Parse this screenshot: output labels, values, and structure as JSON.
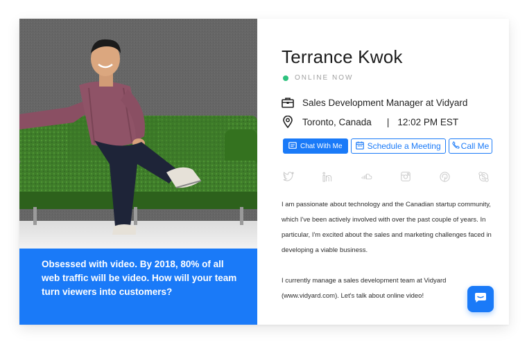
{
  "profile": {
    "name": "Terrance Kwok",
    "status": "ONLINE NOW",
    "role": "Sales Development Manager at Vidyard",
    "location": "Toronto, Canada",
    "separator": "|",
    "local_time": "12:02 PM EST"
  },
  "actions": {
    "chat_label": "Chat With Me",
    "meeting_label": "Schedule a Meeting",
    "call_label": "Call Me"
  },
  "socials": [
    "twitter-icon",
    "linkedin-icon",
    "soundcloud-icon",
    "instagram-icon",
    "pinterest-icon",
    "skype-icon"
  ],
  "bio": {
    "paragraph_1": "I am passionate about technology and the Canadian startup community, which I've been actively involved with over the past couple of years. In particular, I'm excited about the sales and marketing challenges faced in developing a viable business.",
    "paragraph_2": "I currently manage a sales development team at Vidyard (www.vidyard.com). Let's talk about online video!"
  },
  "banner": {
    "quote": "Obsessed with video. By 2018, 80% of all web traffic will be video. How will your team turn viewers into customers?"
  },
  "colors": {
    "accent": "#1a7af8",
    "status_online": "#2ec27e",
    "icon_gray": "#c9c9c9"
  }
}
